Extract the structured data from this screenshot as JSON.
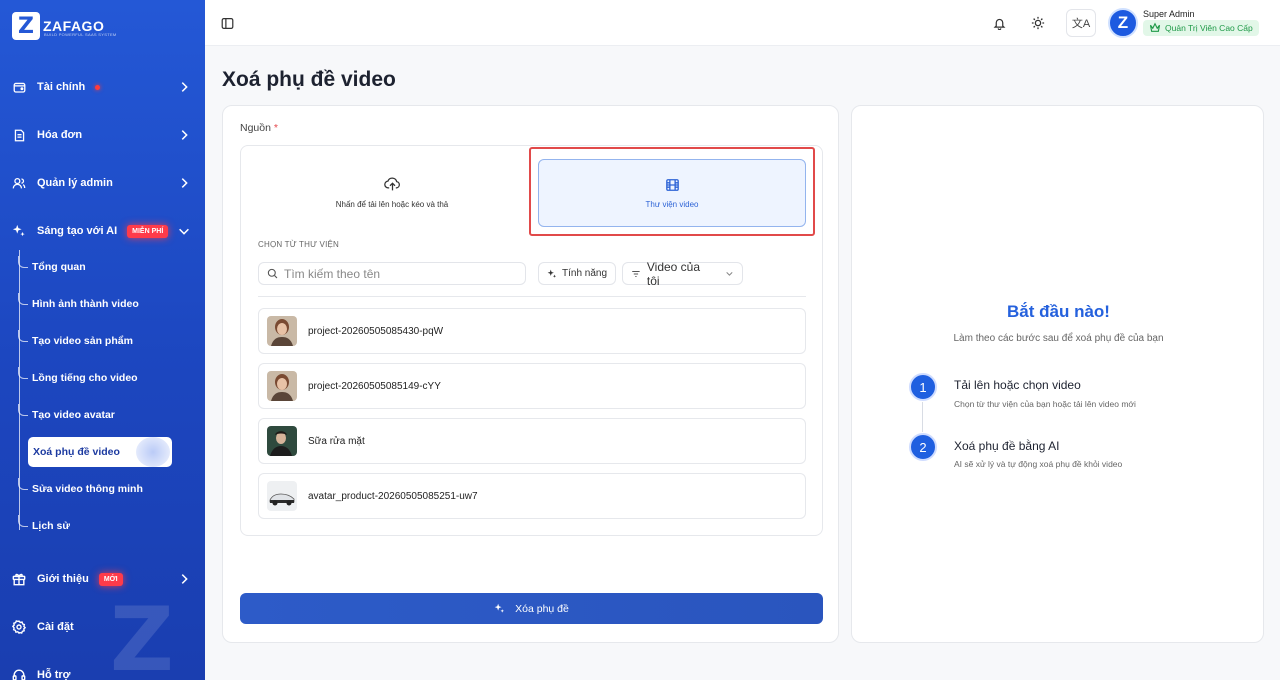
{
  "brand": {
    "logo_text": "ZAFAGO",
    "logo_sub": "BUILD POWERFUL SAAS SYSTEM",
    "logo_letter": "Z",
    "watermark": "Z"
  },
  "sidebar": {
    "items": [
      {
        "label": "Tài chính",
        "icon": "wallet-icon"
      },
      {
        "label": "Hóa đơn",
        "icon": "invoice-icon"
      },
      {
        "label": "Quản lý admin",
        "icon": "users-icon"
      },
      {
        "label": "Sáng tạo với AI",
        "icon": "sparkle-icon",
        "badge": "MIỄN PHÍ"
      },
      {
        "label": "Giới thiệu",
        "icon": "gift-icon",
        "badge": "MỚI"
      },
      {
        "label": "Cài đặt",
        "icon": "settings-icon"
      },
      {
        "label": "Hỗ trợ",
        "icon": "support-icon"
      }
    ],
    "sub_items": [
      "Tổng quan",
      "Hình ảnh thành video",
      "Tạo video sản phẩm",
      "Lồng tiếng cho video",
      "Tạo video avatar",
      "Xoá phụ đề video",
      "Sửa video thông minh",
      "Lịch sử"
    ]
  },
  "header": {
    "user_name": "Super Admin",
    "user_role": "Quản Trị Viên Cao Cấp",
    "avatar_letter": "Z",
    "lang_glyph": "文A"
  },
  "page": {
    "title": "Xoá phụ đề video"
  },
  "form": {
    "source_label": "Nguồn",
    "required_mark": "*",
    "upload_label": "Nhấn để tải lên hoặc kéo và thả",
    "library_label": "Thư viện video",
    "library_heading": "CHỌN TỪ THƯ VIỆN",
    "search_placeholder": "Tìm kiếm theo tên",
    "feature_label": "Tính năng",
    "filter_label": "Video của tôi",
    "videos": [
      "project-20260505085430-pqW",
      "project-20260505085149-cYY",
      "Sữa rửa mặt",
      "avatar_product-20260505085251-uw7"
    ],
    "submit_label": "Xóa phụ đề"
  },
  "guide": {
    "title": "Bắt đầu nào!",
    "subtitle": "Làm theo các bước sau để xoá phụ đề của bạn",
    "steps": [
      {
        "num": "1",
        "title": "Tải lên hoặc chọn video",
        "desc": "Chọn từ thư viện của bạn hoặc tải lên video mới"
      },
      {
        "num": "2",
        "title": "Xoá phụ đề bằng AI",
        "desc": "AI sẽ xử lý và tự động xoá phụ đề khỏi video"
      }
    ]
  },
  "colors": {
    "sidebar_bg": "#2458d6",
    "accent": "#2561dd",
    "badge_red": "#ff3b4a",
    "highlight": "#e14a4a",
    "role_green": "#1f9a48"
  }
}
